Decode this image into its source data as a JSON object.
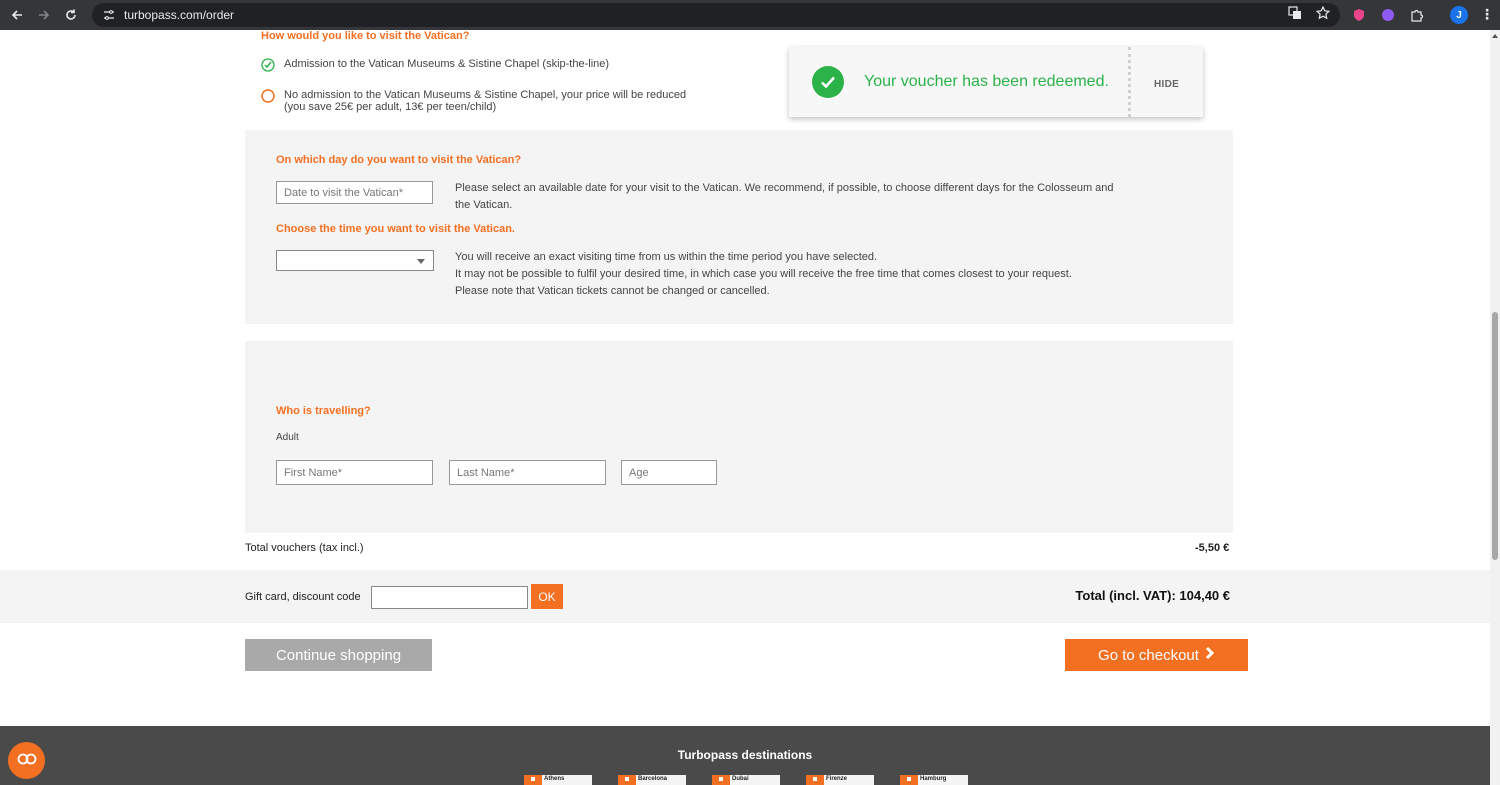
{
  "browser": {
    "url": "turbopass.com/order",
    "avatar_initial": "J"
  },
  "visit": {
    "question": "How would you like to visit the Vatican?",
    "option_admission": "Admission to the Vatican Museums & Sistine Chapel (skip-the-line)",
    "option_no_admission_line1": "No admission to the Vatican Museums & Sistine Chapel, your price will be reduced",
    "option_no_admission_line2": "(you save 25€ per adult, 13€ per teen/child)",
    "selected": "admission"
  },
  "day": {
    "label": "On which day do you want to visit the Vatican?",
    "date_placeholder": "Date to visit the Vatican*",
    "help_line1": "Please select an available date for your visit to the Vatican. We recommend, if possible, to choose different days for the Colosseum and",
    "help_line2": "the Vatican."
  },
  "time": {
    "label": "Choose the time you want to visit the Vatican.",
    "selected_value": "",
    "help_line1": "You will receive an exact visiting time from us within the time period you have selected.",
    "help_line2": "It may not be possible to fulfil your desired time, in which case you will receive the free time that comes closest to your request.",
    "help_line3": "Please note that Vatican tickets cannot be changed or cancelled."
  },
  "travellers": {
    "label": "Who is travelling?",
    "type": "Adult",
    "first_name_placeholder": "First Name*",
    "last_name_placeholder": "Last Name*",
    "age_placeholder": "Age"
  },
  "totals": {
    "vouchers_label": "Total vouchers (tax incl.)",
    "vouchers_value": "-5,50 €",
    "gift_label": "Gift card, discount code",
    "gift_value": "",
    "ok_label": "OK",
    "total_label": "Total (incl. VAT): 104,40 €"
  },
  "actions": {
    "continue_label": "Continue shopping",
    "checkout_label": "Go to checkout"
  },
  "footer": {
    "title": "Turbopass destinations",
    "destinations": [
      "Athens",
      "Barcelona",
      "Dubai",
      "Firenze",
      "Hamburg"
    ]
  },
  "toast": {
    "message": "Your voucher has been redeemed.",
    "hide_label": "HIDE"
  },
  "colors": {
    "accent": "#f36f21",
    "success": "#2bb34a",
    "panel_bg": "#f4f4f4",
    "footer_bg": "#4a4a4a",
    "button_grey": "#a9a9a9"
  }
}
